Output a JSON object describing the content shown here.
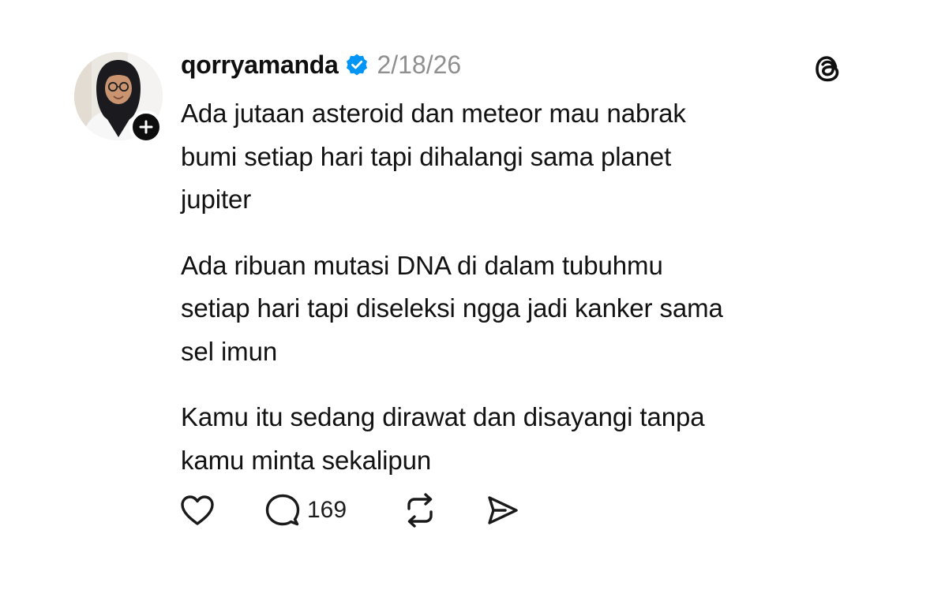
{
  "post": {
    "username": "qorryamanda",
    "date": "2/18/26",
    "verified_icon": "verified-badge-icon",
    "paragraphs": [
      "Ada jutaan asteroid dan meteor mau nabrak\nbumi setiap hari tapi dihalangi sama planet\njupiter",
      "Ada ribuan mutasi DNA di dalam tubuhmu\nsetiap hari tapi diseleksi ngga jadi kanker sama\nsel imun",
      "Kamu itu sedang dirawat dan disayangi tanpa\nkamu minta sekalipun"
    ],
    "actions": {
      "like_icon": "heart-icon",
      "reply_icon": "comment-icon",
      "reply_count": "169",
      "repost_icon": "repost-icon",
      "share_icon": "send-icon"
    }
  },
  "colors": {
    "text": "#121212",
    "muted": "#8f8f8f",
    "verified": "#0095f6",
    "badge": "#0d0d0d"
  }
}
